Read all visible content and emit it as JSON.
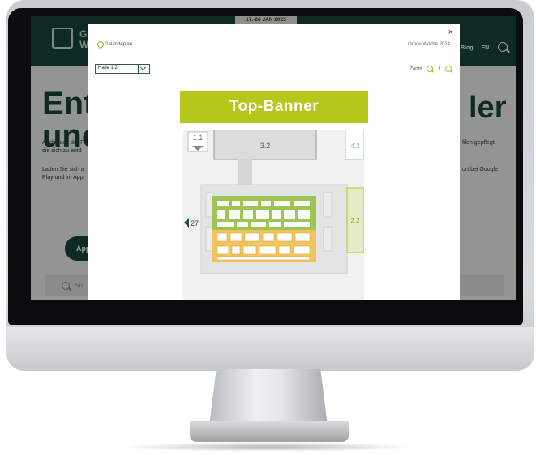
{
  "website": {
    "logo_text": [
      "G",
      "W"
    ],
    "date_banner": "17.-26 JAN 2025",
    "header_links": [
      "Blog",
      "EN"
    ],
    "hero_title_left": [
      "Ent",
      "unc"
    ],
    "hero_title_right": "ler",
    "paragraph_1": [
      "Auch nach der F",
      "die sich zu entd"
    ],
    "paragraph_1_right": "filen gepflegt,",
    "paragraph_2": [
      "Laden Sie sich a",
      "Play und im App"
    ],
    "paragraph_2_right": [
      "ort bei Google"
    ],
    "app_button": "App",
    "search_placeholder": "Su"
  },
  "modal": {
    "close": "×",
    "plan_label": "Geländeplan",
    "fair_label": "Grüne Woche 2024",
    "hall_select": "Halle 1.2",
    "zoom_label": "Zoom",
    "zoom_level": "1",
    "banner": "Top-Banner"
  },
  "map": {
    "halls": {
      "h11": "1.1",
      "h32": "3.2",
      "h42": "4.2",
      "h22": "2.2",
      "h27": "27"
    }
  },
  "colors": {
    "brand_dark": "#16463b",
    "accent_lime": "#b5c71b",
    "booth_green": "#9cc553",
    "booth_orange": "#f2c45e"
  }
}
